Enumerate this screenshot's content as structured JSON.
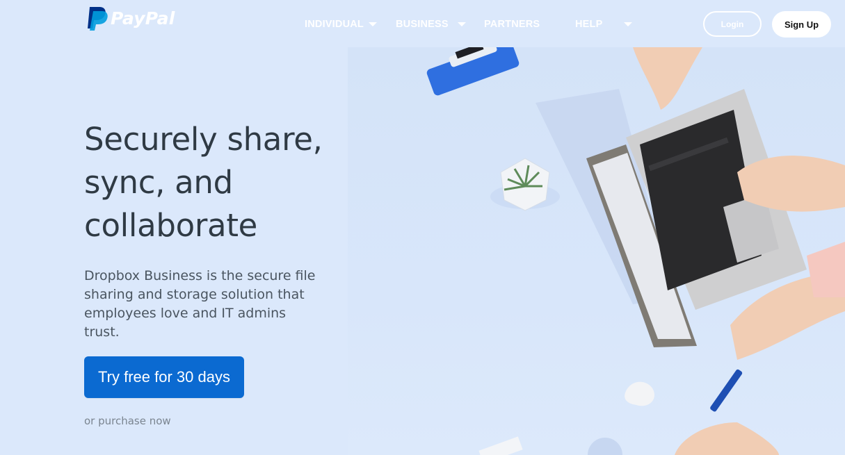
{
  "brand": {
    "name": "PayPal"
  },
  "nav": {
    "items": [
      {
        "label": "INDIVIDUAL",
        "has_dropdown": true
      },
      {
        "label": "BUSINESS",
        "has_dropdown": true
      },
      {
        "label": "PARTNERS",
        "has_dropdown": false
      },
      {
        "label": "HELP",
        "has_dropdown": true
      }
    ],
    "login_label": "Login",
    "signup_label": "Sign Up"
  },
  "hero": {
    "headline_lines": [
      "Securely share,",
      "sync, and",
      "collaborate"
    ],
    "subcopy_lines": [
      "Dropbox Business is the secure file",
      "sharing and storage solution that",
      "employees love and IT admins trust."
    ],
    "cta_label": "Try free for 30 days",
    "purchase_label": "or purchase now"
  },
  "colors": {
    "background": "#dbe8fb",
    "cta": "#0b6ad1",
    "paypal_dark": "#003087",
    "paypal_light": "#009cde"
  }
}
